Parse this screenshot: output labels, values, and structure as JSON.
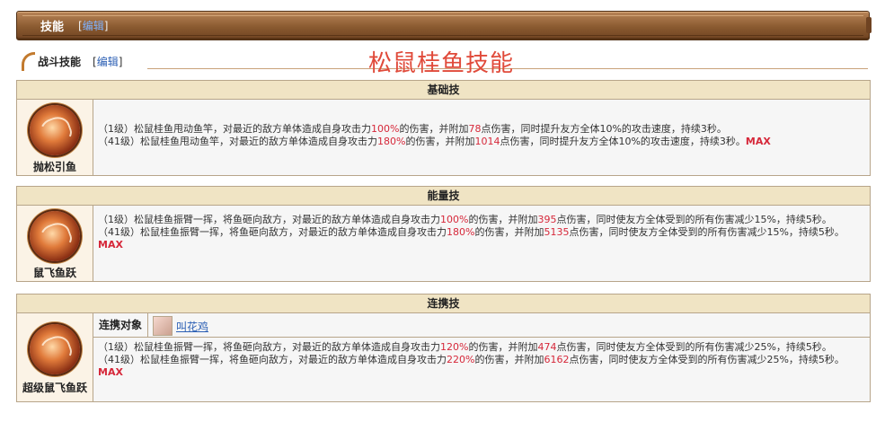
{
  "banner": {
    "title": "技能",
    "edit_prefix": "[",
    "edit_link": "编辑",
    "edit_suffix": "]"
  },
  "section": {
    "label": "战斗技能",
    "edit_prefix": "[",
    "edit_link": "编辑",
    "edit_suffix": "]"
  },
  "page_heading": "松鼠桂鱼技能",
  "skills": [
    {
      "type": "基础技",
      "name": "抛松引鱼",
      "lines": [
        {
          "p1": "（1级）松鼠桂鱼甩动鱼竿，对最近的敌方单体造成自身攻击力",
          "v1": "100%",
          "p2": "的伤害，并附加",
          "v2": "78",
          "p3": "点伤害，同时提升友方全体10%的攻击速度，持续3秒。",
          "max": ""
        },
        {
          "p1": "（41级）松鼠桂鱼甩动鱼竿，对最近的敌方单体造成自身攻击力",
          "v1": "180%",
          "p2": "的伤害，并附加",
          "v2": "1014",
          "p3": "点伤害，同时提升友方全体10%的攻击速度，持续3秒。",
          "max": "MAX"
        }
      ]
    },
    {
      "type": "能量技",
      "name": "鼠飞鱼跃",
      "lines": [
        {
          "p1": "（1级）松鼠桂鱼振臂一挥，将鱼砸向敌方，对最近的敌方单体造成自身攻击力",
          "v1": "100%",
          "p2": "的伤害，并附加",
          "v2": "395",
          "p3": "点伤害，同时使友方全体受到的所有伤害减少15%，持续5秒。",
          "max": ""
        },
        {
          "p1": "（41级）松鼠桂鱼振臂一挥，将鱼砸向敌方，对最近的敌方单体造成自身攻击力",
          "v1": "180%",
          "p2": "的伤害，并附加",
          "v2": "5135",
          "p3": "点伤害，同时使友方全体受到的所有伤害减少15%，持续5秒。",
          "max": "MAX"
        }
      ]
    },
    {
      "type": "连携技",
      "name": "超级鼠飞鱼跃",
      "partner_label": "连携对象",
      "partner_name": "叫花鸡",
      "lines": [
        {
          "p1": "（1级）松鼠桂鱼振臂一挥，将鱼砸向敌方，对最近的敌方单体造成自身攻击力",
          "v1": "120%",
          "p2": "的伤害，并附加",
          "v2": "474",
          "p3": "点伤害，同时使友方全体受到的所有伤害减少25%，持续5秒。",
          "max": ""
        },
        {
          "p1": "（41级）松鼠桂鱼振臂一挥，将鱼砸向敌方，对最近的敌方单体造成自身攻击力",
          "v1": "220%",
          "p2": "的伤害，并附加",
          "v2": "6162",
          "p3": "点伤害，同时使友方全体受到的所有伤害减少25%，持续5秒。",
          "max": "MAX"
        }
      ]
    }
  ],
  "colors": {
    "value_red": "#d6283a",
    "heading_red": "#e04a3a",
    "link_blue": "#2b5fb4",
    "banner_brown": "#8a5a30",
    "header_tan": "#f0e4c4"
  }
}
